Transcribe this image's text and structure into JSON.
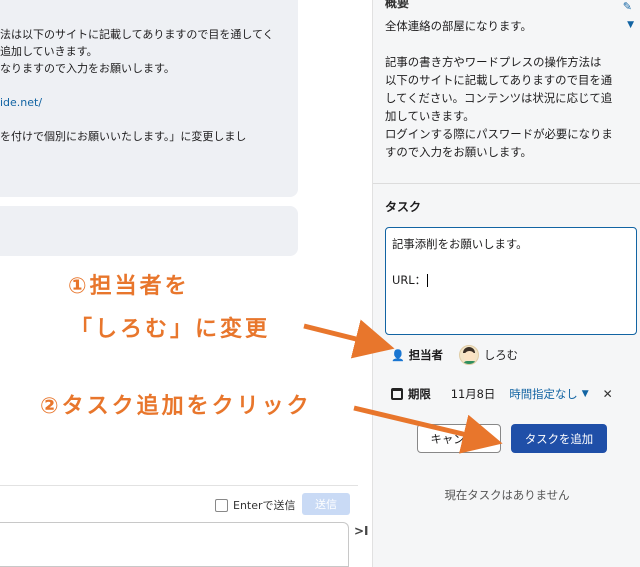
{
  "chat": {
    "message_lines": [
      "法は以下のサイトに記載してありますので目を通してく",
      "追加していきます。",
      "なりますので入力をお願いします。",
      "",
      "ide.net/",
      "",
      "を付けで個別にお願いいたします。」に変更しまし"
    ],
    "enter_to_send_label": "Enterで送信",
    "send_label": "送信",
    "collapse_label": ">I"
  },
  "sidebar": {
    "overview_title": "概要",
    "overview_lines": [
      "全体連絡の部屋になります。",
      "",
      "記事の書き方やワードプレスの操作方法は",
      "以下のサイトに記載してありますので目を通",
      "してください。コンテンツは状況に応じて追",
      "加していきます。",
      "ログインする際にパスワードが必要になりま",
      "すので入力をお願いします。"
    ],
    "task": {
      "title": "タスク",
      "textarea_lines": [
        "記事添削をお願いします。",
        "",
        "URL："
      ],
      "assignee_label": "担当者",
      "assignee_name": "しろむ",
      "due_label": "期限",
      "due_date": "11月8日",
      "time_option": "時間指定なし",
      "cancel_label": "キャンセル",
      "add_label": "タスクを追加",
      "empty_message": "現在タスクはありません"
    }
  },
  "annotations": {
    "step1_line1": "①担当者を",
    "step1_line2": "「しろむ」に変更",
    "step2": "②タスク追加をクリック",
    "color": "#e8762c"
  }
}
